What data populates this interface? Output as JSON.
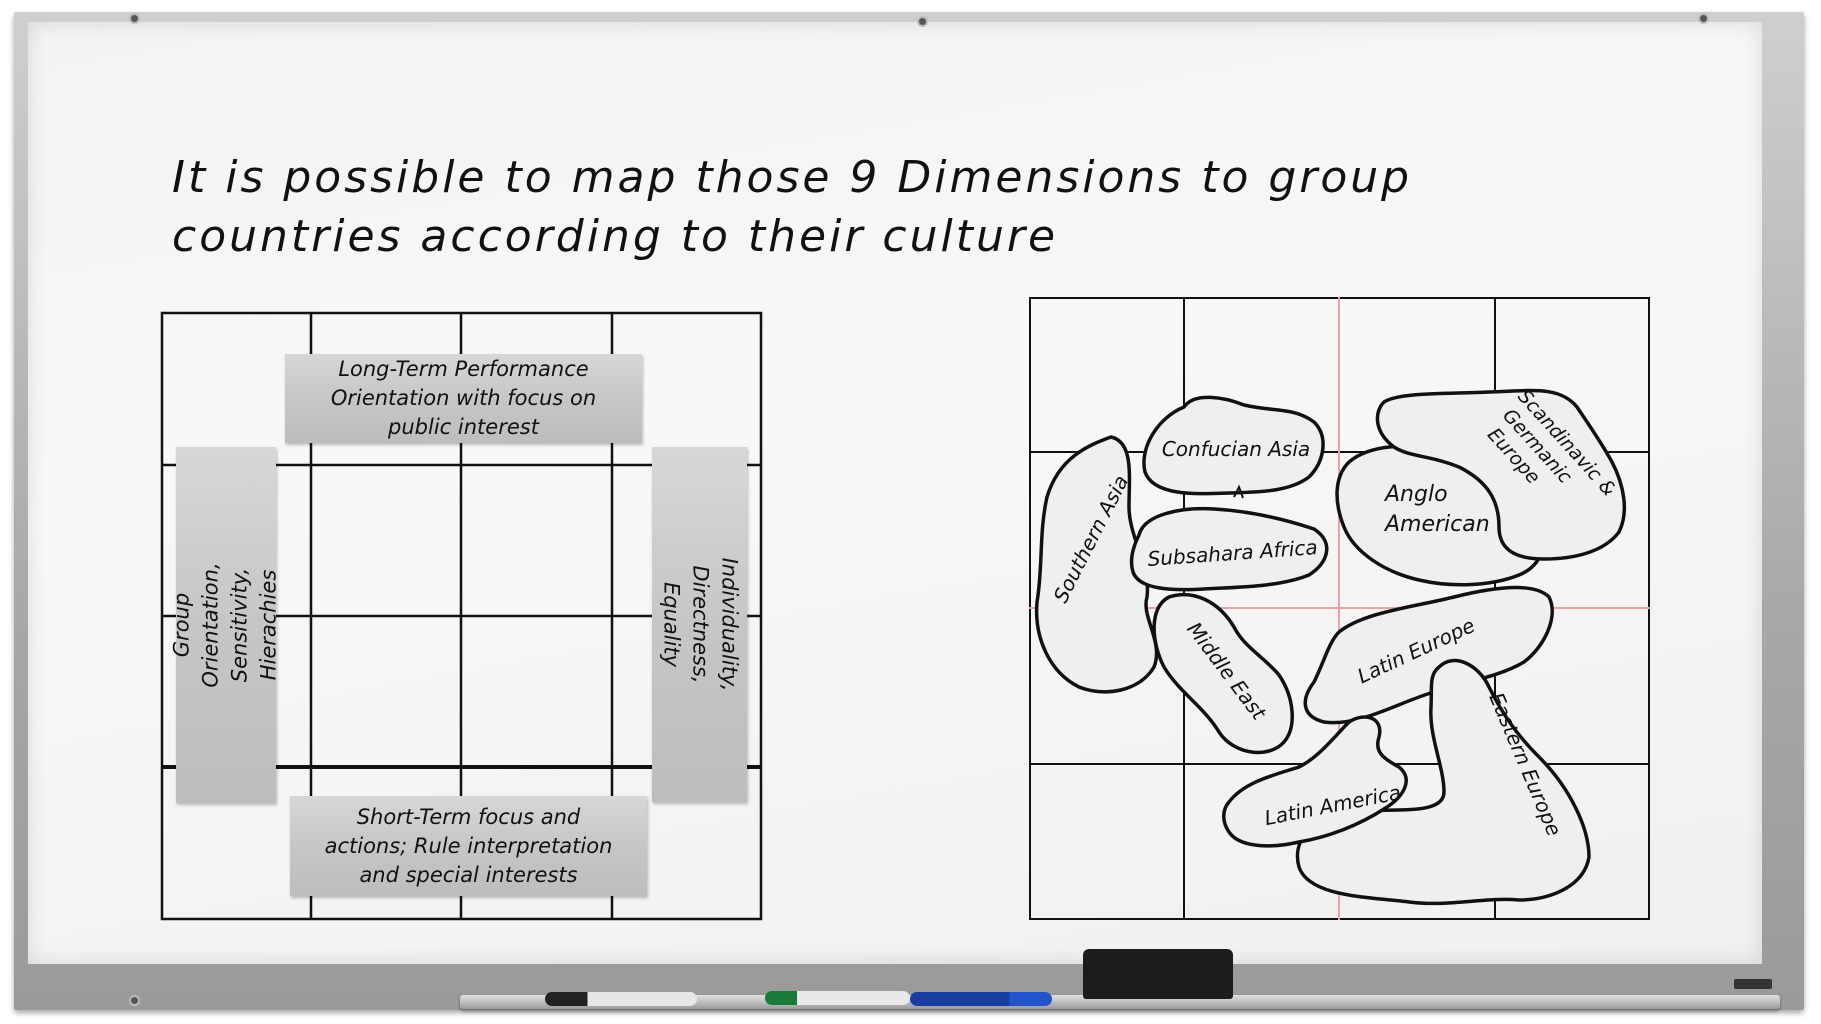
{
  "title": "It is possible to map those 9 Dimensions to group\ncountries according to their culture",
  "dimensions": {
    "top": "Long-Term Performance\nOrientation with focus on\npublic interest",
    "bottom": "Short-Term focus and\nactions; Rule interpretation\nand special interests",
    "left": "Group Orientation,\nSensitivity, Hierachies",
    "right": "Individuality, Directness,\nEquality"
  },
  "regions": {
    "confucian_asia": "Confucian Asia",
    "southern_asia": "Southern Asia",
    "subsahara_africa": "Subsahara Africa",
    "middle_east": "Middle East",
    "anglo_american_1": "Anglo",
    "anglo_american_2": "American",
    "scandinavic_1": "Scandinavic &",
    "scandinavic_2": "Germanic",
    "scandinavic_3": "Europe",
    "latin_europe": "Latin Europe",
    "latin_america": "Latin America",
    "eastern_europe": "Eastern Europe"
  },
  "colors": {
    "region_fill": "#efefef",
    "grid_line": "#111111",
    "center_line": "#e8a0a0",
    "box_fill": "#c9c9c9"
  }
}
